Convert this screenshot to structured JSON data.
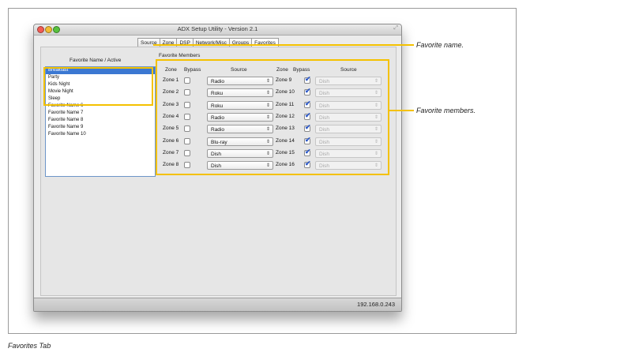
{
  "window": {
    "title": "ADX Setup Utility - Version 2.1",
    "ip": "192.168.0.243"
  },
  "tabs": [
    {
      "label": "Source"
    },
    {
      "label": "Zone"
    },
    {
      "label": "DSP"
    },
    {
      "label": "Network/Misc"
    },
    {
      "label": "Groups"
    },
    {
      "label": "Favorites"
    }
  ],
  "favorites": {
    "header": "Favorite Name / Active",
    "items": [
      "Breakfast",
      "Party",
      "Kids Night",
      "Movie Night",
      "Sleep",
      "Favorite Name 6",
      "Favorite Name 7",
      "Favorite Name 8",
      "Favorite Name 9",
      "Favorite Name 10"
    ]
  },
  "members": {
    "header": "Favorite Members",
    "col_zone": "Zone",
    "col_bypass": "Bypass",
    "col_source": "Source",
    "left": [
      {
        "zone": "Zone 1",
        "source": "Radio"
      },
      {
        "zone": "Zone 2",
        "source": "Roku"
      },
      {
        "zone": "Zone 3",
        "source": "Roku"
      },
      {
        "zone": "Zone 4",
        "source": "Radio"
      },
      {
        "zone": "Zone 5",
        "source": "Radio"
      },
      {
        "zone": "Zone 6",
        "source": "Blu-ray"
      },
      {
        "zone": "Zone 7",
        "source": "Dish"
      },
      {
        "zone": "Zone 8",
        "source": "Dish"
      }
    ],
    "right": [
      {
        "zone": "Zone 9",
        "source": "Dish"
      },
      {
        "zone": "Zone 10",
        "source": "Dish"
      },
      {
        "zone": "Zone 11",
        "source": "Dish"
      },
      {
        "zone": "Zone 12",
        "source": "Dish"
      },
      {
        "zone": "Zone 13",
        "source": "Dish"
      },
      {
        "zone": "Zone 14",
        "source": "Dish"
      },
      {
        "zone": "Zone 15",
        "source": "Dish"
      },
      {
        "zone": "Zone 16",
        "source": "Dish"
      }
    ]
  },
  "annotations": {
    "name": "Favorite name.",
    "members": "Favorite members."
  },
  "caption": "Favorites Tab",
  "colors": {
    "highlight": "#f4c100",
    "selection": "#3b78d2"
  }
}
